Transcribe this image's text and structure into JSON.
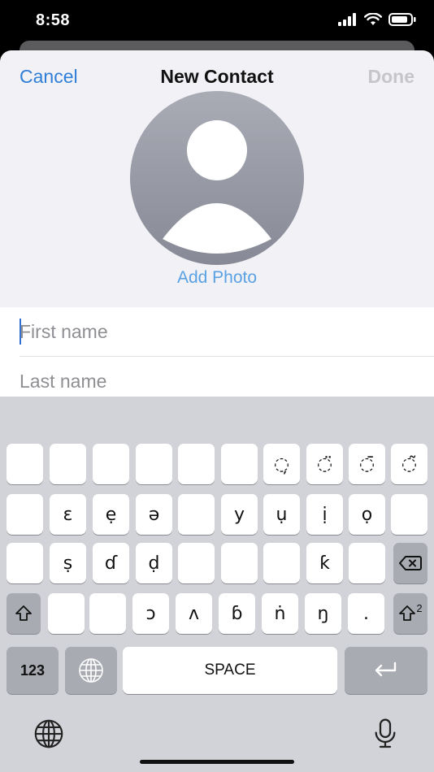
{
  "status": {
    "time": "8:58"
  },
  "nav": {
    "cancel_label": "Cancel",
    "title": "New Contact",
    "done_label": "Done"
  },
  "photo": {
    "add_label": "Add Photo"
  },
  "fields": {
    "first_name_placeholder": "First name",
    "last_name_placeholder": "Last name"
  },
  "keyboard": {
    "row1": [
      "",
      "",
      "",
      "",
      "",
      "",
      "◌̦",
      "◌̈",
      "◌̄",
      "◌̃"
    ],
    "row2": [
      "",
      "ɛ",
      "ẹ",
      "ə",
      "",
      "y",
      "ụ",
      "ị",
      "ọ",
      ""
    ],
    "row3": [
      "",
      "ṣ",
      "ɗ",
      "ḍ",
      "",
      "",
      "",
      "ƙ",
      ""
    ],
    "row4": [
      "",
      "",
      "ɔ",
      "ʌ",
      "ɓ",
      "ṅ",
      "ŋ",
      "."
    ],
    "numbers_label": "123",
    "space_label": "SPACE",
    "shift_super": "2"
  },
  "colors": {
    "accent": "#2f7ed8",
    "add_photo": "#5aa1e3",
    "done_disabled": "#c5c5ca",
    "keyboard_bg": "#d2d3d8",
    "dark_key": "#a9abb3"
  }
}
